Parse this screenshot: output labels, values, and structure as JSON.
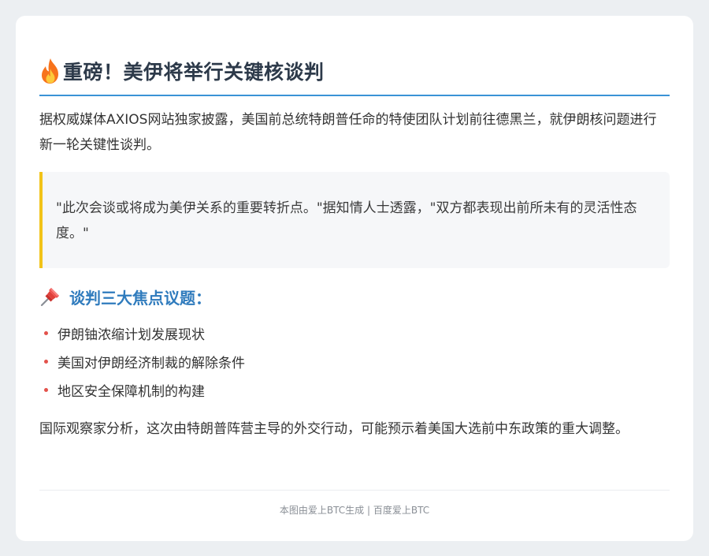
{
  "article": {
    "title": "重磅！美伊将举行关键核谈判",
    "intro": "据权威媒体AXIOS网站独家披露，美国前总统特朗普任命的特使团队计划前往德黑兰，就伊朗核问题进行新一轮关键性谈判。",
    "quote": "\"此次会谈或将成为美伊关系的重要转折点。\"据知情人士透露，\"双方都表现出前所未有的灵活性态度。\"",
    "section_title": "谈判三大焦点议题：",
    "points": [
      "伊朗铀浓缩计划发展现状",
      "美国对伊朗经济制裁的解除条件",
      "地区安全保障机制的构建"
    ],
    "analysis": "国际观察家分析，这次由特朗普阵营主导的外交行动，可能预示着美国大选前中东政策的重大调整。",
    "footer": "本图由爱上BTC生成 | 百度爱上BTC"
  },
  "icons": {
    "title_icon": "fire-icon",
    "section_icon": "pushpin-icon"
  },
  "colors": {
    "accent_blue": "#3a93d6",
    "section_title": "#2f7bbd",
    "quote_border": "#f2c318",
    "bullet": "#e3524b"
  }
}
